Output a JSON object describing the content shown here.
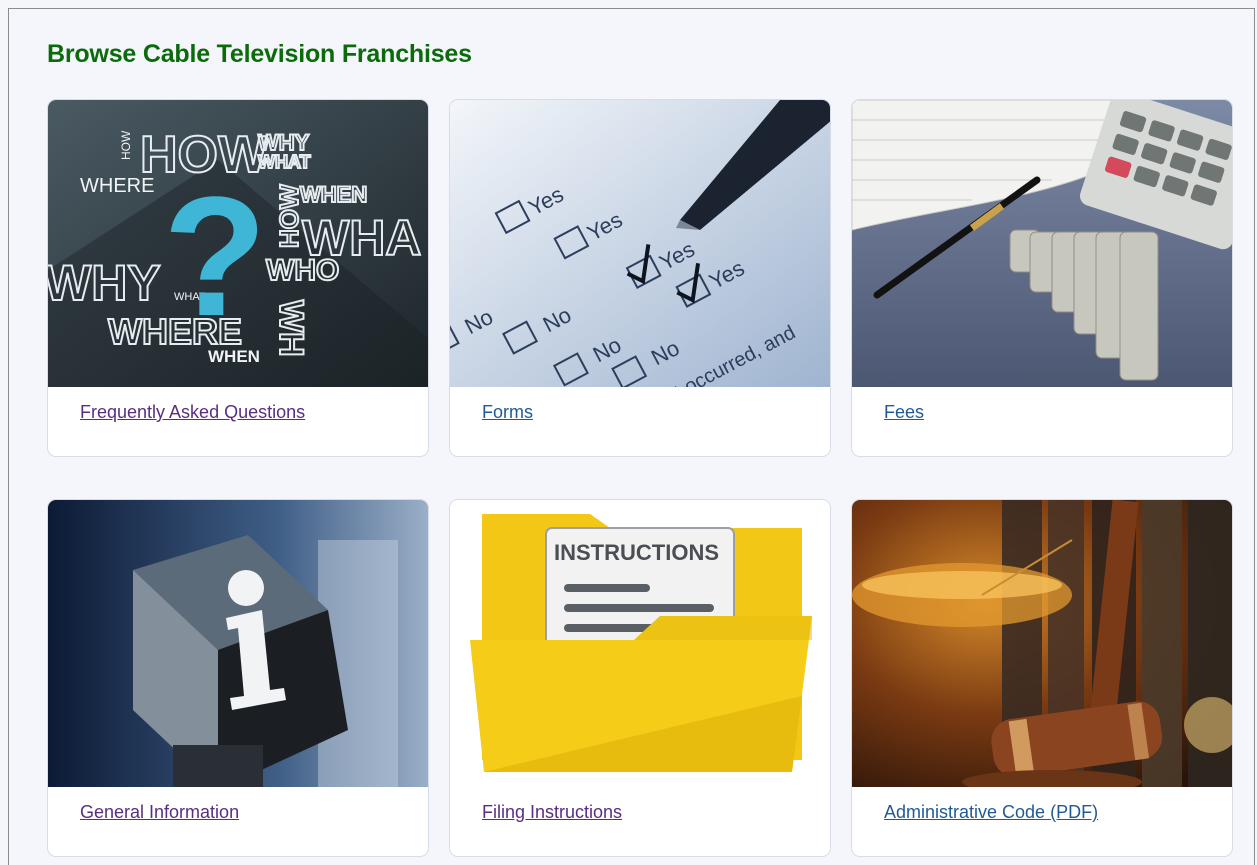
{
  "page": {
    "title": "Browse Cable Television Franchises"
  },
  "cards": [
    {
      "label": "Frequently Asked Questions",
      "image_icon": "question-words-icon",
      "words": {
        "how": "HOW",
        "why": "WHY",
        "what": "WHAT",
        "where": "WHERE",
        "when": "WHEN",
        "who": "WHO",
        "who_v": "WHO",
        "how_v": "HOW",
        "wha": "WHA",
        "why2": "WHY",
        "what2": "WHAT",
        "where2": "WHERE",
        "when2": "WHEN",
        "how2": "HOW",
        "wh": "WH"
      }
    },
    {
      "label": "Forms",
      "image_icon": "checklist-form-icon",
      "words": {
        "yes": "Yes",
        "no": "No",
        "occurred": "it occurred, and"
      }
    },
    {
      "label": "Fees",
      "image_icon": "calculator-coins-icon"
    },
    {
      "label": "General Information",
      "image_icon": "info-cube-icon"
    },
    {
      "label": "Filing Instructions",
      "image_icon": "instructions-folder-icon",
      "words": {
        "instructions": "INSTRUCTIONS"
      }
    },
    {
      "label": "Administrative Code (PDF)",
      "image_icon": "gavel-scales-icon"
    }
  ],
  "colors": {
    "title": "#0b6b0b",
    "visited_link": "#5a2d82",
    "link": "#1f5a96"
  }
}
